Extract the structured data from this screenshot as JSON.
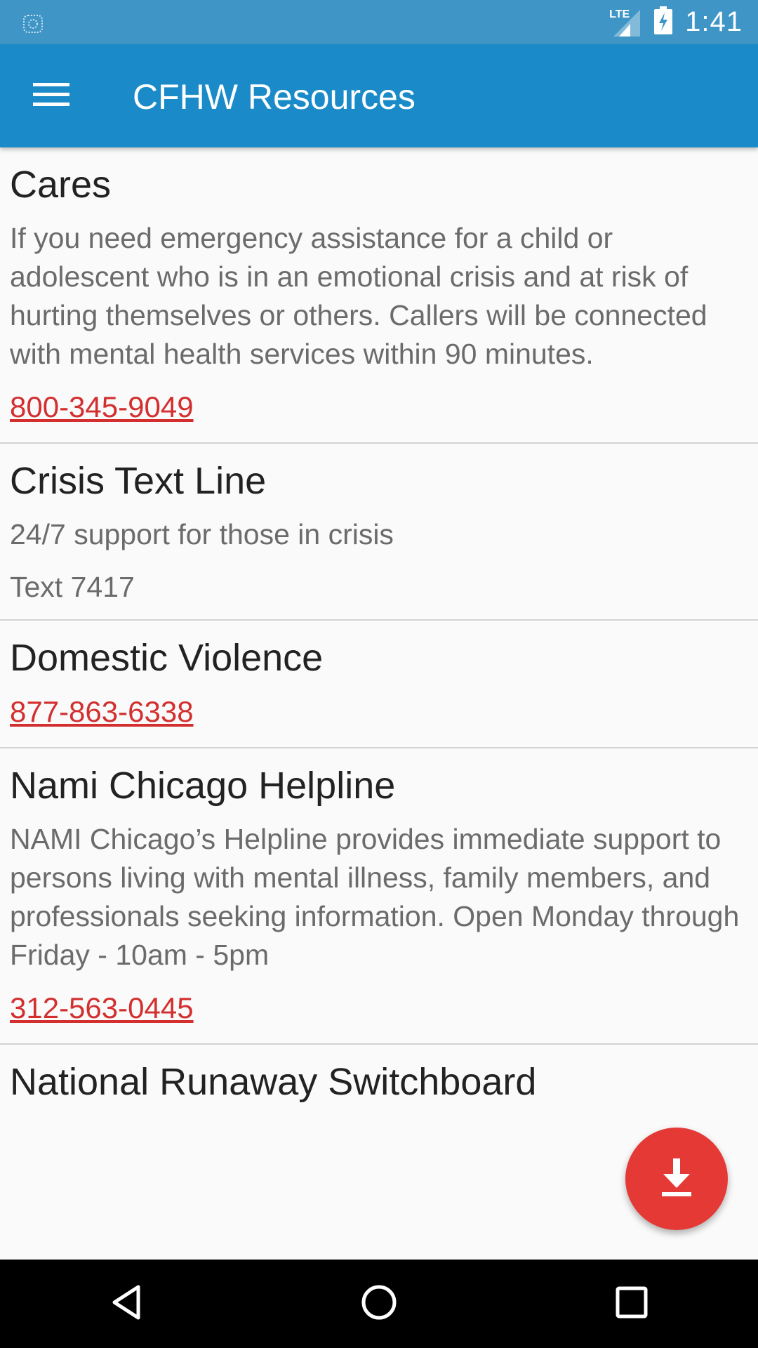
{
  "status_bar": {
    "time": "1:41",
    "network_label": "LTE",
    "icons": [
      "notification-icon",
      "lte-signal-icon",
      "battery-charging-icon"
    ]
  },
  "app_bar": {
    "title": "CFHW Resources",
    "menu_icon": "hamburger-menu-icon"
  },
  "resources": [
    {
      "title": "Cares",
      "description": "If you need emergency assistance for a child or adolescent who is in an emotional crisis and at risk of hurting themselves or others. Callers will be connected with mental health services within 90 minutes.",
      "phone": "800-345-9049"
    },
    {
      "title": "Crisis Text Line",
      "description": "24/7 support for those in crisis",
      "text": "Text 7417"
    },
    {
      "title": "Domestic Violence",
      "phone": "877-863-6338"
    },
    {
      "title": "Nami Chicago Helpline",
      "description": "NAMI Chicago’s Helpline provides immediate support to persons living with mental illness, family members, and professionals seeking information. Open Monday through Friday - 10am - 5pm",
      "phone": "312-563-0445"
    },
    {
      "title": "National Runaway Switchboard"
    }
  ],
  "fab": {
    "icon": "download-icon"
  },
  "nav_bar": {
    "icons": [
      "back-icon",
      "home-icon",
      "recents-icon"
    ]
  },
  "colors": {
    "status_bar": "#3f96c6",
    "app_bar": "#1a8bc8",
    "accent_red": "#e53935",
    "link_red": "#d32f2f",
    "background": "#fafafa"
  }
}
